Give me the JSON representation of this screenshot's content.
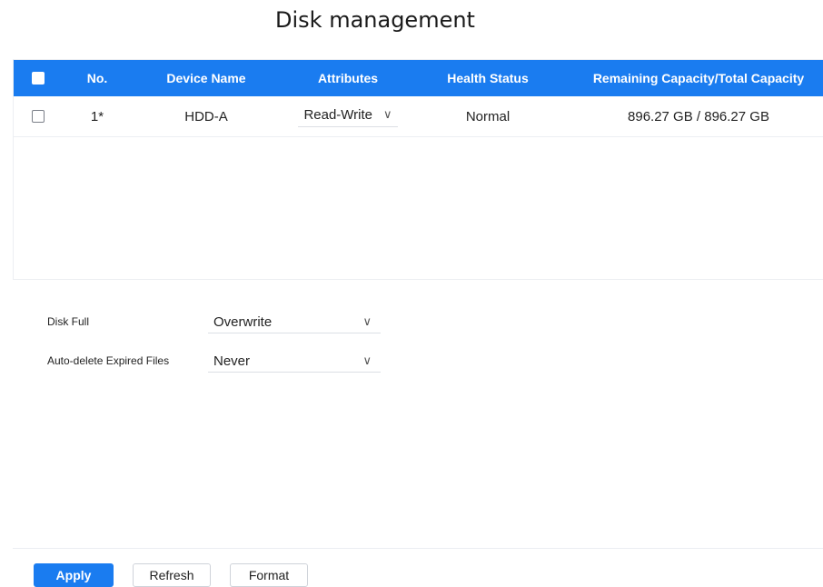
{
  "page": {
    "title": "Disk management"
  },
  "table": {
    "columns": [
      "No.",
      "Device Name",
      "Attributes",
      "Health Status",
      "Remaining Capacity/Total Capacity"
    ],
    "rows": [
      {
        "no": "1*",
        "device_name": "HDD-A",
        "attributes": "Read-Write",
        "health_status": "Normal",
        "capacity": "896.27 GB / 896.27 GB"
      }
    ]
  },
  "settings": {
    "disk_full": {
      "label": "Disk Full",
      "value": "Overwrite"
    },
    "auto_delete": {
      "label": "Auto-delete Expired Files",
      "value": "Never"
    }
  },
  "buttons": {
    "apply": "Apply",
    "refresh": "Refresh",
    "format": "Format"
  },
  "colors": {
    "accent": "#1a7cf0"
  }
}
